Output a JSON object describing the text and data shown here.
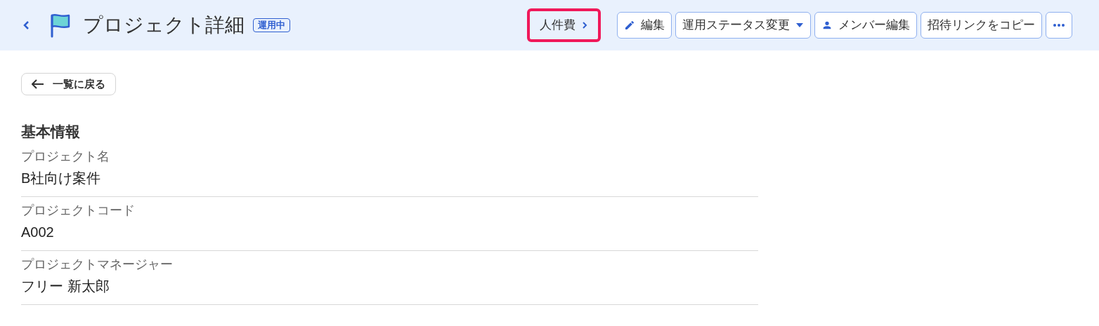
{
  "header": {
    "title": "プロジェクト詳細",
    "status_badge": "運用中",
    "actions": [
      {
        "kind": "link",
        "label": "人件費",
        "highlighted": true
      },
      {
        "kind": "edit",
        "label": "編集",
        "highlighted": false
      },
      {
        "kind": "dropdown",
        "label": "運用ステータス変更",
        "highlighted": false
      },
      {
        "kind": "member",
        "label": "メンバー編集",
        "highlighted": false
      },
      {
        "kind": "plain",
        "label": "招待リンクをコピー",
        "highlighted": false
      },
      {
        "kind": "more",
        "highlighted": false
      }
    ]
  },
  "back_button": "一覧に戻る",
  "section": {
    "title": "基本情報",
    "fields": [
      {
        "label": "プロジェクト名",
        "value": "B社向け案件"
      },
      {
        "label": "プロジェクトコード",
        "value": "A002"
      },
      {
        "label": "プロジェクトマネージャー",
        "value": "フリー 新太郎"
      }
    ]
  }
}
